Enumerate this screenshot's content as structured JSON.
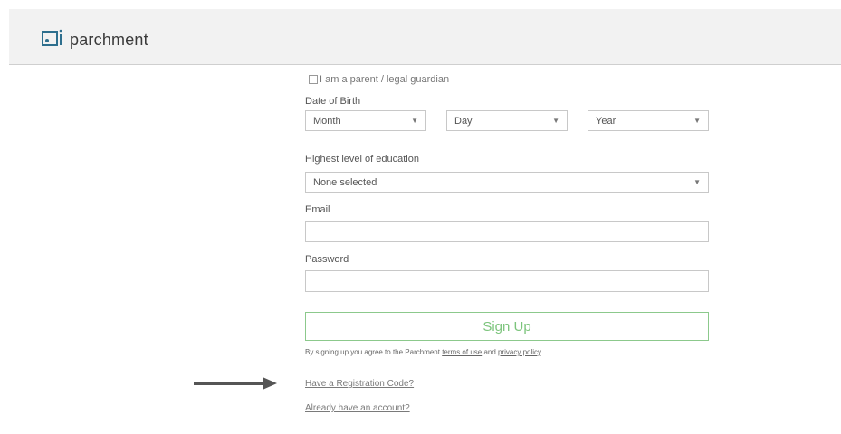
{
  "header": {
    "logo_text": "parchment"
  },
  "form": {
    "guardian_label": "I am a parent / legal guardian",
    "dob_label": "Date of Birth",
    "month": "Month",
    "day": "Day",
    "year": "Year",
    "education_label": "Highest level of education",
    "education_value": "None selected",
    "email_label": "Email",
    "password_label": "Password",
    "signup": "Sign Up",
    "terms_prefix": "By signing up you agree to the Parchment ",
    "terms_link": "terms of use",
    "terms_and": " and ",
    "privacy_link": "privacy policy",
    "terms_suffix": ".",
    "registration_link": "Have a Registration Code?",
    "account_link": "Already have an account?"
  },
  "colors": {
    "accent_green": "#7cc47c",
    "header_bg": "#f2f2f2",
    "logo_blue": "#2e6f8e"
  }
}
